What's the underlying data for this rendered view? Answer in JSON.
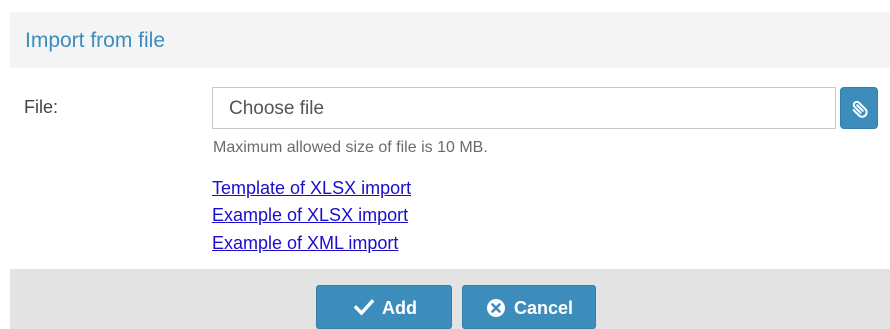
{
  "dialog": {
    "title": "Import from file"
  },
  "form": {
    "file_label": "File:",
    "file_input_text": "Choose file",
    "help_text": "Maximum allowed size of file is 10 MB.",
    "attach_icon": "paperclip-icon"
  },
  "links": [
    "Template of XLSX import",
    "Example of XLSX import",
    "Example of XML import"
  ],
  "footer": {
    "add_label": "Add",
    "add_icon": "checkmark-icon",
    "cancel_label": "Cancel",
    "cancel_icon": "times-circle-icon"
  },
  "colors": {
    "accent": "#3c8dbc",
    "title": "#3c8dbc",
    "link": "#1a0dcc",
    "header_bg": "#f4f4f4",
    "footer_bg": "#e3e3e3"
  }
}
